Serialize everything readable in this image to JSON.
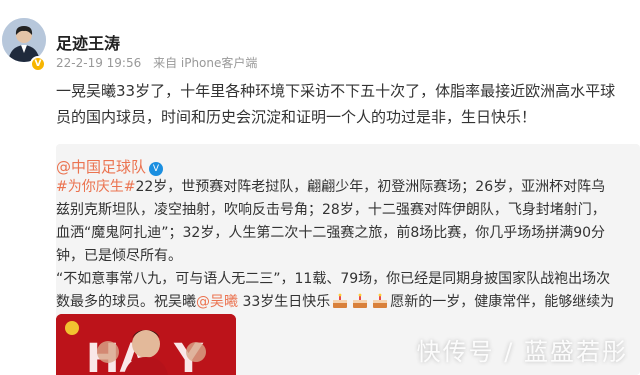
{
  "post": {
    "author": "足迹王涛",
    "time": "22-2-19 19:56",
    "source": "来自 iPhone客户端",
    "body": "一晃吴曦33岁了，十年里各种环境下采访不下五十次了，体脂率最接近欧洲高水平球员的国内球员，时间和历史会沉淀和证明一个人的功过是非，生日快乐！"
  },
  "repost": {
    "author": "@中国足球队",
    "verified_mark": "V",
    "hashtag": "#为你庆生#",
    "text_1": "22岁，世预赛对阵老挝队，翩翩少年，初登洲际赛场；26岁，亚洲杯对阵乌兹别克斯坦队，凌空抽射，吹响反击号角；28岁，十二强赛对阵伊朗队，飞身封堵射门，血洒“魔鬼阿扎迪”；32岁，人生第二次十二强赛之旅，前8场比赛，你几乎场场拼满90分钟，已是倾尽所有。",
    "text_2": "“不如意事常八九，可与语人无二三”，11载、79场，你已经是同期身披国家队战袍出场次数最多的球员。祝吴曦",
    "mention": "@吴曦",
    "text_3": " 33岁生日快乐",
    "text_4": "愿新的一岁，健康常伴，能够继续为你热爱的足球事业贡献力量。"
  },
  "watermark": "快传号 / 蓝盛若彤",
  "colors": {
    "link": "#eb7350",
    "quote_bg": "#f4f4f4",
    "badge_gold": "#f7b500",
    "badge_blue": "#1b8fe0"
  }
}
